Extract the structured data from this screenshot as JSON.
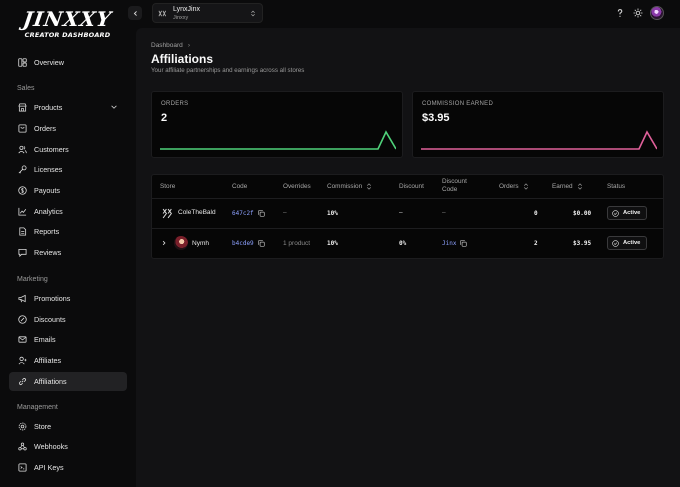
{
  "app": {
    "logo_text": "JINXXY",
    "logo_subtitle": "CREATOR DASHBOARD"
  },
  "sidebar": {
    "overview": "Overview",
    "sections": {
      "sales": "Sales",
      "marketing": "Marketing",
      "management": "Management"
    },
    "sales_items": [
      {
        "label": "Products",
        "icon": "store-icon"
      },
      {
        "label": "Orders",
        "icon": "orders-icon"
      },
      {
        "label": "Customers",
        "icon": "users-icon"
      },
      {
        "label": "Licenses",
        "icon": "key-icon"
      },
      {
        "label": "Payouts",
        "icon": "dollar-icon"
      },
      {
        "label": "Analytics",
        "icon": "chart-icon"
      },
      {
        "label": "Reports",
        "icon": "report-icon"
      },
      {
        "label": "Reviews",
        "icon": "review-icon"
      }
    ],
    "marketing_items": [
      {
        "label": "Promotions",
        "icon": "megaphone-icon"
      },
      {
        "label": "Discounts",
        "icon": "discount-icon"
      },
      {
        "label": "Emails",
        "icon": "mail-icon"
      },
      {
        "label": "Affiliates",
        "icon": "affiliates-icon"
      },
      {
        "label": "Affiliations",
        "icon": "link-icon",
        "active": true
      }
    ],
    "management_items": [
      {
        "label": "Store",
        "icon": "store-settings-icon"
      },
      {
        "label": "Webhooks",
        "icon": "webhook-icon"
      },
      {
        "label": "API Keys",
        "icon": "api-key-icon"
      }
    ]
  },
  "topbar": {
    "store_name": "LynxJinx",
    "store_sub": "Jinxxy"
  },
  "page": {
    "breadcrumb": "Dashboard",
    "breadcrumb_sep": "›",
    "title": "Affiliations",
    "subtitle": "Your affiliate partnerships and earnings across all stores"
  },
  "stats": {
    "orders_label": "ORDERS",
    "orders_value": "2",
    "commission_label": "COMMISSION EARNED",
    "commission_value": "$3.95",
    "orders_color": "#4fd27a",
    "commission_color": "#e0609a"
  },
  "table": {
    "headers": {
      "store": "Store",
      "code": "Code",
      "overrides": "Overrides",
      "commission": "Commission",
      "discount": "Discount",
      "discount_code_1": "Discount",
      "discount_code_2": "Code",
      "orders": "Orders",
      "earned": "Earned",
      "status": "Status"
    },
    "rows": [
      {
        "store": "ColeTheBald",
        "code": "647c2f",
        "overrides": "–",
        "commission": "10%",
        "discount": "–",
        "discount_code": "–",
        "orders": "0",
        "earned": "$0.00",
        "status": "Active"
      },
      {
        "store": "Nymh",
        "code": "b4cde9",
        "overrides": "1 product",
        "commission": "10%",
        "discount": "0%",
        "discount_code": "Jinx",
        "orders": "2",
        "earned": "$3.95",
        "status": "Active"
      }
    ]
  }
}
